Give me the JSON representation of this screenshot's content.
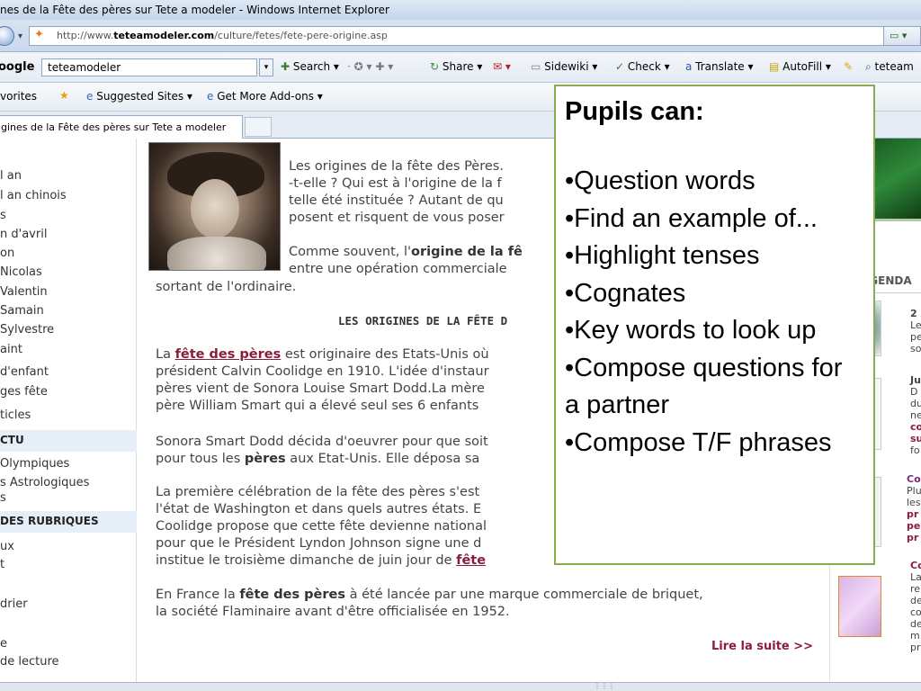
{
  "window": {
    "title": "nes de la Fête des pères sur Tete a modeler - Windows Internet Explorer"
  },
  "address_bar": {
    "url_prefix": "http://www.",
    "url_domain": "teteamodeler.com",
    "url_path": "/culture/fetes/fete-pere-origine.asp"
  },
  "toolbar": {
    "google_label": "oogle",
    "search_value": "teteamodeler",
    "search_button": "Search",
    "share": "Share",
    "sidewiki": "Sidewiki",
    "check": "Check",
    "translate": "Translate",
    "autofill": "AutoFill",
    "trailing": "teteam"
  },
  "favorites_bar": {
    "favorites": "vorites",
    "suggested_sites": "Suggested Sites",
    "get_more_addons": "Get More Add-ons"
  },
  "tab": {
    "active_label": "gines de la Fête des pères sur Tete a modeler"
  },
  "left_nav": {
    "items_top": [
      "l an",
      "l an chinois",
      "s",
      "n d'avril",
      "on",
      "Nicolas",
      "Valentin",
      "Samain",
      "Sylvestre",
      "aint",
      "d'enfant",
      "ges fête",
      "ticles"
    ],
    "section_actu": "CTU",
    "items_actu": [
      "Olympiques",
      "s Astrologiques",
      "s"
    ],
    "section_rubriques": "DES RUBRIQUES",
    "items_rubriques": [
      "ux",
      "t",
      "drier",
      "e",
      "de lecture"
    ]
  },
  "article": {
    "p1_l1": "Les origines de la fête des Pères.",
    "p1_l2": "-t-elle ? Qui est à l'origine de la f",
    "p1_l3": "telle été instituée ? Autant de qu",
    "p1_l4": "posent et risquent de vous poser",
    "p2_l1_pre": "Comme souvent, l'",
    "p2_l1_bold": "origine de la fê",
    "p2_l2": "entre une opération commerciale",
    "p2_l3": "sortant de l'ordinaire.",
    "heading": "LES ORIGINES DE LA FÊTE D",
    "p3_l1_pre": "La ",
    "p3_l1_link": "fête des pères",
    "p3_l1_post": " est originaire des Etats-Unis où",
    "p3_l2": "président Calvin Coolidge en 1910. L'idée d'instaur",
    "p3_l3": "pères vient de Sonora Louise Smart Dodd.La mère",
    "p3_l4": "père William Smart qui a élevé seul ses 6 enfants",
    "p4_l1": "Sonora Smart Dodd décida d'oeuvrer pour que soit",
    "p4_l2_pre": "pour tous les ",
    "p4_l2_bold": "pères",
    "p4_l2_post": " aux Etat-Unis. Elle déposa sa",
    "p5_l1": "La première célébration de la fête des pères s'est",
    "p5_l2": "l'état de Washington et dans quels autres états. E",
    "p5_l3": "Coolidge propose que cette fête devienne national",
    "p5_l4": "pour que le Président Lyndon Johnson signe une d",
    "p5_l5_pre": "institue le troisième dimanche de juin jour de ",
    "p5_l5_link": "fête",
    "p6_l1_pre": "En France la ",
    "p6_l1_bold": "fête des pères",
    "p6_l1_post": " à été lancée par une marque commerciale de briquet,",
    "p6_l2": "la société Flaminaire avant d'être officialisée en 1952.",
    "read_more": "Lire la suite >>"
  },
  "right_col": {
    "agenda": "AGENDA",
    "snippets": [
      [
        "2",
        "Le",
        "pe",
        "so"
      ],
      [
        "Ju",
        "D",
        "du",
        "ne",
        "co",
        "su",
        "fo"
      ],
      [
        "Co",
        "Plu",
        "les",
        "pr",
        "pe",
        "pr"
      ],
      [
        "Co",
        "La",
        "re",
        "de",
        "co",
        "de",
        "m",
        "pr"
      ]
    ]
  },
  "overlay": {
    "title": "Pupils can:",
    "items": [
      "•Question words",
      "•Find an example of...",
      "•Highlight tenses",
      "•Cognates",
      "•Key words to look up",
      "•Compose questions for",
      "a partner",
      "•Compose T/F phrases"
    ]
  }
}
